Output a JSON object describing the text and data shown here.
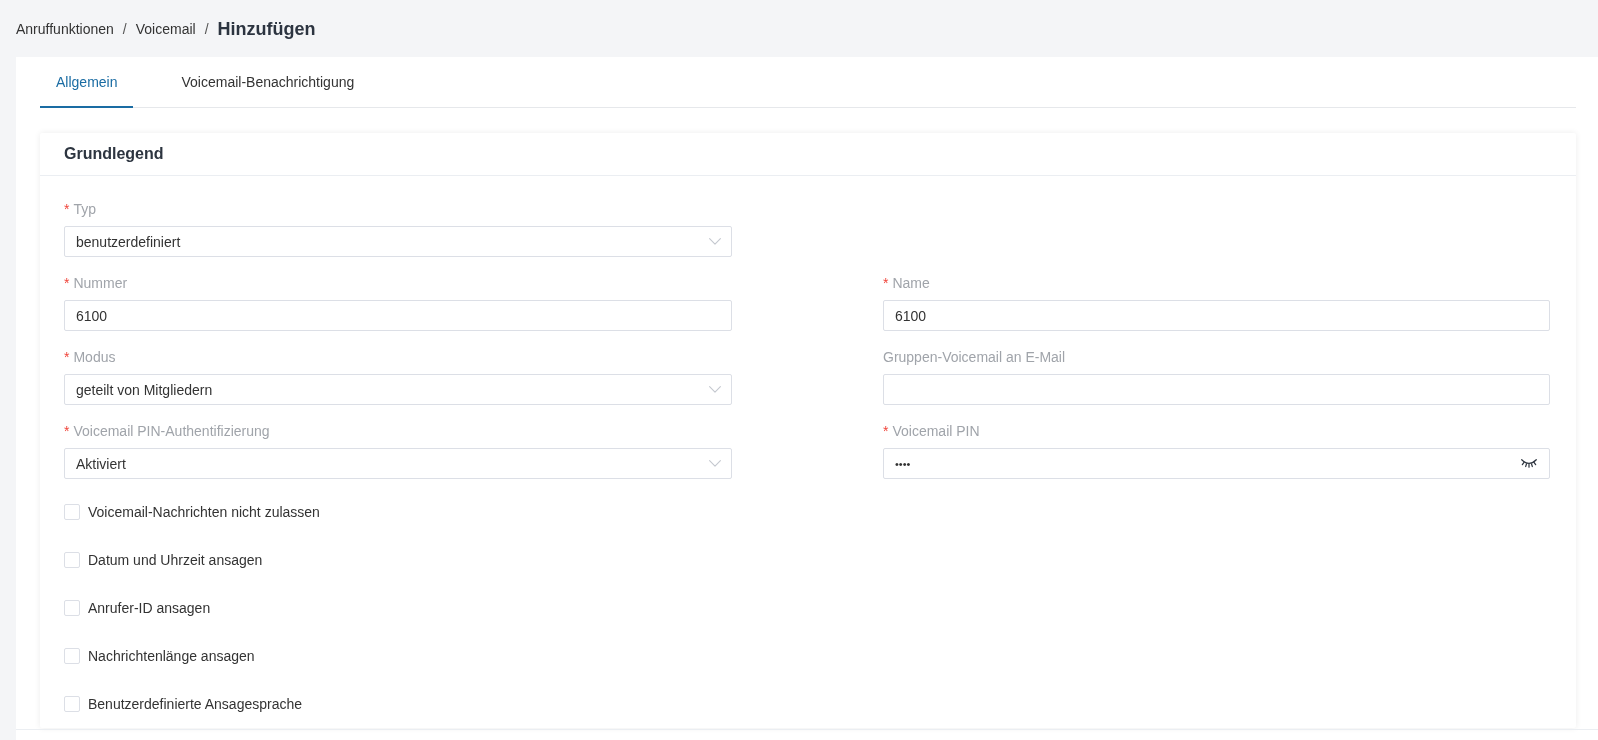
{
  "breadcrumb": [
    {
      "label": "Anruffunktionen",
      "separator": "/",
      "current": false
    },
    {
      "label": "Voicemail",
      "separator": "/",
      "current": false
    },
    {
      "label": "Hinzufügen",
      "current": true
    }
  ],
  "tabs": [
    {
      "label": "Allgemein",
      "selected": true
    },
    {
      "label": "Voicemail-Benachrichtigung",
      "selected": false
    }
  ],
  "section": {
    "title": "Grundlegend",
    "field_rows": [
      [
        {
          "kind": "select",
          "marker": "*",
          "label": "Typ",
          "value": "benutzerdefiniert"
        }
      ],
      [
        {
          "kind": "text",
          "marker": "*",
          "label": "Nummer",
          "value": "6100"
        },
        {
          "kind": "text",
          "marker": "*",
          "label": "Name",
          "value": "6100"
        }
      ],
      [
        {
          "kind": "select",
          "marker": "*",
          "label": "Modus",
          "value": "geteilt von Mitgliedern"
        },
        {
          "kind": "text",
          "label": "Gruppen-Voicemail an E-Mail"
        }
      ],
      [
        {
          "kind": "select",
          "marker": "*",
          "label": "Voicemail PIN-Authentifizierung",
          "value": "Aktiviert"
        },
        {
          "kind": "password",
          "marker": "*",
          "label": "Voicemail PIN",
          "value": "••••"
        }
      ]
    ],
    "checkboxes": [
      {
        "label": "Voicemail-Nachrichten nicht zulassen",
        "checked": false
      },
      {
        "label": "Datum und Uhrzeit ansagen",
        "checked": false
      },
      {
        "label": "Anrufer-ID ansagen",
        "checked": false
      },
      {
        "label": "Nachrichtenlänge ansagen",
        "checked": false
      },
      {
        "label": "Benutzerdefinierte Ansagesprache",
        "checked": false
      }
    ]
  }
}
